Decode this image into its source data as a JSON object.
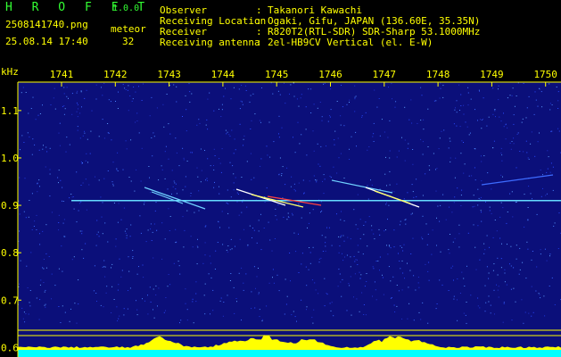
{
  "header": {
    "app_title": "H R O F F T",
    "app_version": "1.0.0",
    "file_name": "2508141740.png",
    "timestamp": "25.08.14 17:40",
    "meteor_label": "meteor",
    "meteor_count": "32",
    "info": [
      {
        "label": "Observer",
        "value": "Takanori Kawachi"
      },
      {
        "label": "Receiving Location",
        "value": "Ogaki, Gifu, JAPAN (136.60E, 35.35N)"
      },
      {
        "label": "Receiver",
        "value": "R820T2(RTL-SDR) SDR-Sharp 53.1000MHz"
      },
      {
        "label": "Receiving antenna",
        "value": "2el-HB9CV Vertical (el. E-W)"
      }
    ],
    "separator": ":"
  },
  "chart_data": {
    "type": "heatmap",
    "ylabel": "kHz",
    "x_ticks": [
      "1741",
      "1742",
      "1743",
      "1744",
      "1745",
      "1746",
      "1747",
      "1748",
      "1749",
      "1750"
    ],
    "y_ticks": [
      "1.1",
      "1.0",
      "0.9",
      "0.8",
      "0.7",
      "0.6"
    ],
    "y_range": [
      0.58,
      1.16
    ],
    "carrier_khz": 0.91,
    "colors": {
      "background": "#0b0f7a",
      "axis": "#ffff00",
      "carrier": "#66ddff",
      "spectrum": "#ffff00",
      "noise_floor": "#00ffff"
    }
  }
}
